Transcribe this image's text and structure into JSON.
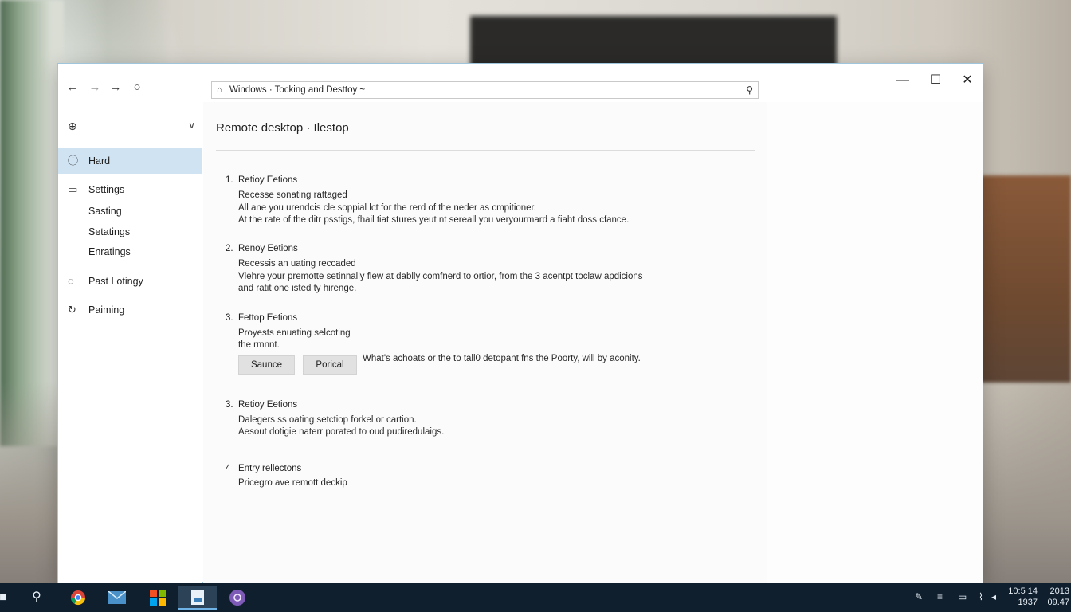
{
  "window": {
    "address": "Windows · Tocking and Desttoy ~",
    "nav": {
      "back": "←",
      "forward": "→",
      "forward2": "→",
      "refresh": "○"
    },
    "controls": {
      "minimize": "—",
      "maximize": "☐",
      "close": "✕"
    }
  },
  "sidebar": {
    "items": [
      {
        "label": "Hard",
        "icon": "info-icon"
      },
      {
        "label": "Settings",
        "icon": "card-icon"
      },
      {
        "label": "Past Lotingy",
        "icon": "chat-icon"
      },
      {
        "label": "Paiming",
        "icon": "refresh-icon"
      }
    ],
    "subitems": [
      "Sasting",
      "Setatings",
      "Enratings"
    ]
  },
  "main": {
    "title": "Remote desktop · Ilestop",
    "sections": [
      {
        "num": "1.",
        "head": "Retioy Eetions",
        "lines": [
          "Recesse sonating rattaged",
          "All ane you urendcis cle soppial lct for the rerd of the neder as cmpitioner.",
          "At the rate of the ditr psstigs, fhail tiat stures yeut nt sereall you veryourmard a fiaht doss cfance."
        ]
      },
      {
        "num": "2.",
        "head": "Renoy Eetions",
        "lines": [
          "Recessis an uating reccaded",
          "Vlehre your premotte setinnally flew at dablly comfnerd to ortior, from the 3 acentpt toclaw apdicions",
          "and ratit one isted ty hirenge."
        ]
      },
      {
        "num": "3.",
        "head": "Fettop Eetions",
        "lines": [
          "Proyests enuating selcoting",
          "the rmnnt."
        ],
        "buttons": [
          "Saunce",
          "Porical"
        ],
        "note": "What's achoats or the to tall0 detopant fns the Poorty, will by aconity."
      },
      {
        "num": "3.",
        "head": "Retioy Eetions",
        "lines": [
          "Dalegers ss oating setctiop forkel or cartion.",
          "Aesout dotigie naterr porated to oud pudiredulaigs."
        ]
      },
      {
        "num": "4",
        "head": "Entry rellectons",
        "lines": [
          "Pricegro ave remott deckip"
        ]
      }
    ]
  },
  "taskbar": {
    "apps": [
      "start-icon",
      "search-icon",
      "chrome-icon",
      "mail-icon",
      "store-icon",
      "file-icon",
      "app-icon"
    ],
    "tray": {
      "wifi": "⌇",
      "time1": "10:5 14",
      "date1": "1937",
      "time2": "2013",
      "date2": "09.47"
    }
  },
  "colors": {
    "accent": "#cfe3f3",
    "taskbar": "#0f1f2e"
  }
}
